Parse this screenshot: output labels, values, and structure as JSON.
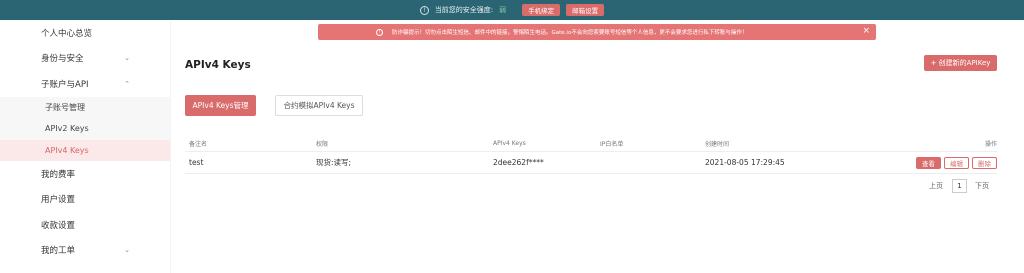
{
  "topbar": {
    "security_label": "当前您的安全强度:",
    "security_level": "弱",
    "phone_button": "手机绑定",
    "email_button": "邮箱设置"
  },
  "sidebar": {
    "items": [
      {
        "label": "个人中心总览",
        "chevron": ""
      },
      {
        "label": "身份与安全",
        "chevron": "⌄"
      },
      {
        "label": "子账户与API",
        "chevron": "⌃"
      }
    ],
    "sub_items": [
      {
        "label": "子账号管理"
      },
      {
        "label": "APIv2 Keys"
      },
      {
        "label": "APIv4 Keys"
      }
    ],
    "items_bottom": [
      {
        "label": "我的费率",
        "chevron": ""
      },
      {
        "label": "用户设置",
        "chevron": ""
      },
      {
        "label": "收款设置",
        "chevron": ""
      },
      {
        "label": "我的工单",
        "chevron": "⌄"
      }
    ]
  },
  "warning": {
    "text": "防诈骗提示！切勿点击陌生短信、邮件中的链接，警惕陌生电话。Gate.io不会向您索要账号短信等个人信息，更不会要求您进行私下转账与操作！",
    "close": "×"
  },
  "page": {
    "title": "APIv4 Keys",
    "create_button": "+ 创建新的APIKey"
  },
  "tabs": [
    {
      "label": "APIv4 Keys管理"
    },
    {
      "label": "合约模拟APIv4 Keys"
    }
  ],
  "table": {
    "headers": [
      "备注名",
      "权限",
      "APIv4 Keys",
      "IP白名单",
      "创建时间",
      "操作"
    ],
    "rows": [
      {
        "name": "test",
        "permission": "现货:读写;",
        "key": "2dee262f****",
        "ip": "",
        "created": "2021-08-05 17:29:45",
        "actions": [
          "查看",
          "编辑",
          "删除"
        ]
      }
    ]
  },
  "pagination": {
    "prev": "上页",
    "current": "1",
    "next": "下页"
  },
  "colors": {
    "header_bg": "#2b6574",
    "accent": "#d96b6b",
    "warning_bg": "#e57575",
    "active_sub_bg": "#fbe9ea"
  }
}
